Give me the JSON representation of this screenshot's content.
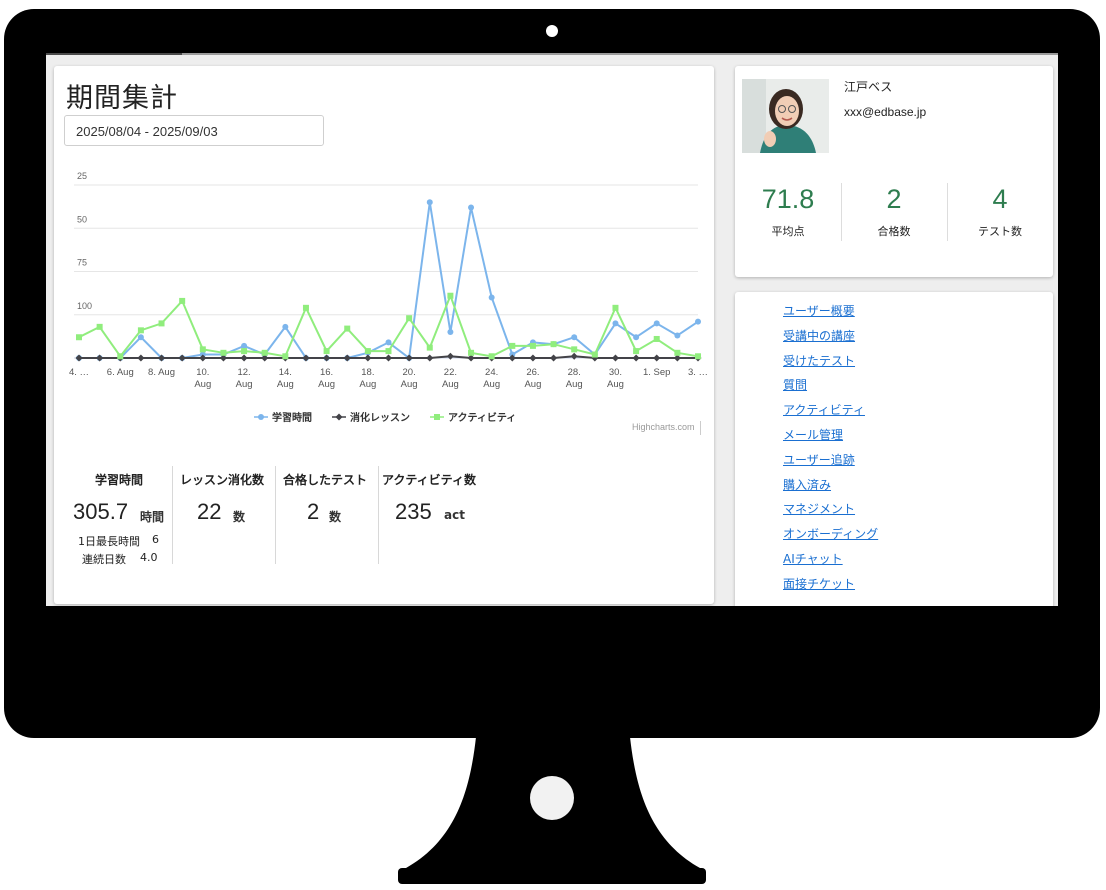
{
  "page": {
    "title": "期間集計",
    "date_range": "2025/08/04 - 2025/09/03"
  },
  "chart_data": {
    "type": "line",
    "x": [
      "4. Aug",
      "5. Aug",
      "6. Aug",
      "7. Aug",
      "8. Aug",
      "9. Aug",
      "10. Aug",
      "11. Aug",
      "12. Aug",
      "13. Aug",
      "14. Aug",
      "15. Aug",
      "16. Aug",
      "17. Aug",
      "18. Aug",
      "19. Aug",
      "20. Aug",
      "21. Aug",
      "22. Aug",
      "23. Aug",
      "24. Aug",
      "25. Aug",
      "26. Aug",
      "27. Aug",
      "28. Aug",
      "29. Aug",
      "30. Aug",
      "31. Aug",
      "1. Sep",
      "2. Sep",
      "3. Sep"
    ],
    "x_tick_labels": [
      "4. …",
      "6. Aug",
      "8. Aug",
      "10. Aug",
      "12. Aug",
      "14. Aug",
      "16. Aug",
      "18. Aug",
      "20. Aug",
      "22. Aug",
      "24. Aug",
      "26. Aug",
      "28. Aug",
      "30. Aug",
      "1. Sep",
      "3. …"
    ],
    "ylim": [
      0,
      100
    ],
    "y_ticks": [
      25,
      50,
      75,
      100
    ],
    "grid": true,
    "legend_position": "bottom-center",
    "series": [
      {
        "name": "学習時間",
        "color": "#7cb5ec",
        "marker": "circle",
        "values": [
          0,
          0,
          0,
          12,
          0,
          0,
          2,
          2,
          7,
          2,
          18,
          0,
          0,
          0,
          3,
          9,
          0,
          90,
          15,
          87,
          35,
          2,
          9,
          8,
          12,
          2,
          20,
          12,
          20,
          13,
          21
        ]
      },
      {
        "name": "消化レッスン",
        "color": "#434348",
        "marker": "diamond",
        "values": [
          0,
          0,
          0,
          0,
          0,
          0,
          0,
          0,
          0,
          0,
          0,
          0,
          0,
          0,
          0,
          0,
          0,
          0,
          1,
          0,
          0,
          0,
          0,
          0,
          1,
          0,
          0,
          0,
          0,
          0,
          0
        ]
      },
      {
        "name": "アクティビティ",
        "color": "#90ed7d",
        "marker": "square",
        "values": [
          12,
          18,
          1,
          16,
          20,
          33,
          5,
          3,
          4,
          3,
          1,
          29,
          4,
          17,
          4,
          4,
          23,
          6,
          36,
          3,
          1,
          7,
          7,
          8,
          5,
          2,
          29,
          4,
          11,
          3,
          1
        ]
      }
    ],
    "y_axis_labels": [
      "100",
      "75",
      "50",
      "25"
    ],
    "credit": "Highcharts.com"
  },
  "stats": {
    "study_time": {
      "label": "学習時間",
      "value": "305.7",
      "unit": "時間",
      "max_day_label": "1日最長時間",
      "max_day_value": "6",
      "streak_label": "連続日数",
      "streak_value": "4.0"
    },
    "lessons": {
      "label": "レッスン消化数",
      "value": "22",
      "unit": "数"
    },
    "tests": {
      "label": "合格したテスト",
      "value": "2",
      "unit": "数"
    },
    "activity": {
      "label": "アクティビティ数",
      "value": "235",
      "unit": "act"
    }
  },
  "profile": {
    "name": "江戸ベス",
    "email": "xxx@edbase.jp",
    "kpis": [
      {
        "value": "71.8",
        "label": "平均点"
      },
      {
        "value": "2",
        "label": "合格数"
      },
      {
        "value": "4",
        "label": "テスト数"
      }
    ]
  },
  "menu": {
    "items": [
      "ユーザー概要",
      "受講中の講座",
      "受けたテスト",
      "質問",
      "アクティビティ",
      "メール管理",
      "ユーザー追跡",
      "購入済み",
      "マネジメント",
      "オンボーディング",
      "AIチャット",
      "面接チケット"
    ]
  }
}
